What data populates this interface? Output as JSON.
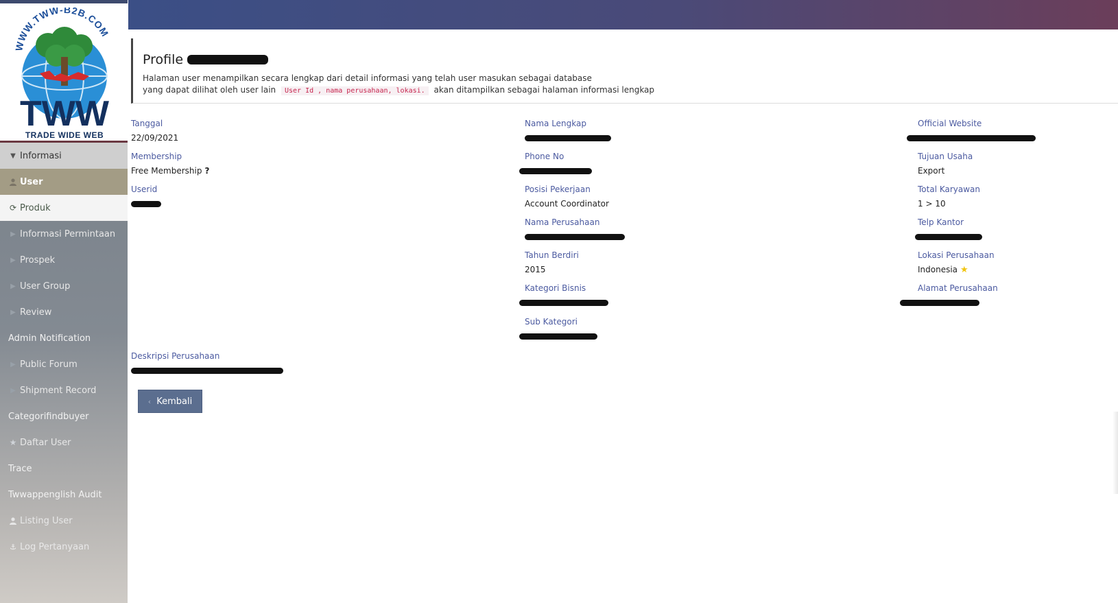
{
  "sidebar": {
    "logo": {
      "top_text": "WWW.TWW-B2B.COM",
      "brand": "TWW",
      "tagline": "TRADE WIDE WEB"
    },
    "items": [
      {
        "label": "Informasi",
        "icon": "caret-down-icon"
      },
      {
        "label": "User",
        "icon": "user-icon"
      },
      {
        "label": "Produk",
        "icon": "refresh-icon"
      },
      {
        "label": "Informasi Permintaan",
        "icon": "caret-right-icon"
      },
      {
        "label": "Prospek",
        "icon": "caret-right-icon"
      },
      {
        "label": "User Group",
        "icon": "caret-right-icon"
      },
      {
        "label": "Review",
        "icon": "caret-right-icon"
      },
      {
        "label": "Admin Notification",
        "icon": ""
      },
      {
        "label": "Public Forum",
        "icon": "caret-right-icon"
      },
      {
        "label": "Shipment Record",
        "icon": "caret-right-icon"
      },
      {
        "label": "Categorifindbuyer",
        "icon": ""
      },
      {
        "label": "Daftar User",
        "icon": "star-icon"
      },
      {
        "label": "Trace",
        "icon": ""
      },
      {
        "label": "Twwappenglish Audit",
        "icon": ""
      },
      {
        "label": "Listing User",
        "icon": "user-icon"
      },
      {
        "label": "Log Pertanyaan",
        "icon": "anchor-icon"
      }
    ]
  },
  "header": {
    "title": "Profile",
    "desc_line1": "Halaman user menampilkan secara lengkap dari detail informasi yang telah user masukan sebagai database",
    "desc_line2_pre": "yang dapat dilihat oleh user lain",
    "desc_code": "User Id , nama perusahaan, lokasi.",
    "desc_line2_post": "akan ditampilkan sebagai halaman informasi lengkap"
  },
  "fields": {
    "tanggal": {
      "label": "Tanggal",
      "value": "22/09/2021"
    },
    "membership": {
      "label": "Membership",
      "value": "Free Membership",
      "help": "?"
    },
    "userid": {
      "label": "Userid"
    },
    "nama_lengkap": {
      "label": "Nama Lengkap"
    },
    "phone_no": {
      "label": "Phone No"
    },
    "posisi_pekerjaan": {
      "label": "Posisi Pekerjaan",
      "value": "Account Coordinator"
    },
    "nama_perusahaan": {
      "label": "Nama Perusahaan"
    },
    "tahun_berdiri": {
      "label": "Tahun Berdiri",
      "value": "2015"
    },
    "kategori_bisnis": {
      "label": "Kategori Bisnis"
    },
    "sub_kategori": {
      "label": "Sub Kategori"
    },
    "official_website": {
      "label": "Official Website"
    },
    "tujuan_usaha": {
      "label": "Tujuan Usaha",
      "value": "Export"
    },
    "total_karyawan": {
      "label": "Total Karyawan",
      "value": "1 > 10"
    },
    "telp_kantor": {
      "label": "Telp Kantor"
    },
    "lokasi_perusahaan": {
      "label": "Lokasi Perusahaan",
      "value": "Indonesia"
    },
    "alamat_perusahaan": {
      "label": "Alamat Perusahaan"
    },
    "deskripsi_perusahaan": {
      "label": "Deskripsi Perusahaan"
    }
  },
  "back_button": {
    "label": "Kembali",
    "icon": "chevron-left-icon"
  },
  "colors": {
    "topbar_start": "#3b4f86",
    "topbar_end": "#6b3e5a",
    "label": "#4b5aa0",
    "button": "#5b6e8f"
  }
}
